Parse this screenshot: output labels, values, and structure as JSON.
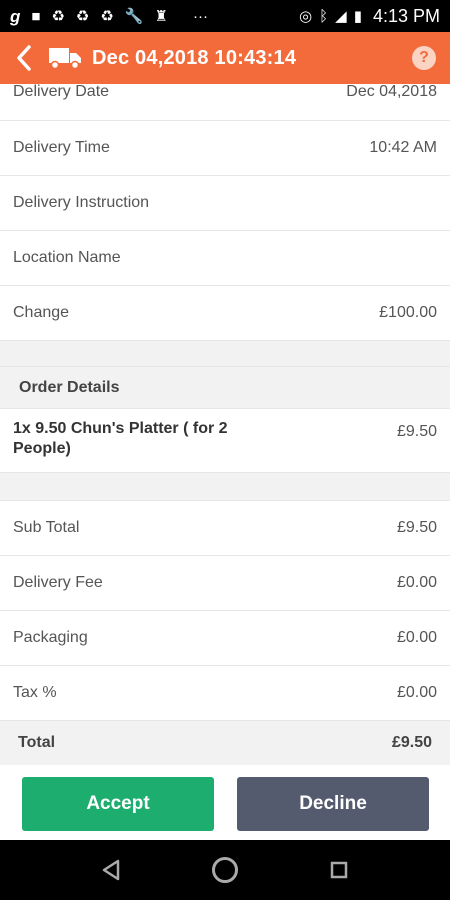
{
  "status_bar": {
    "time": "4:13 PM",
    "icons": [
      "g-icon",
      "square-icon",
      "recycle-icon",
      "recycle-icon",
      "recycle-icon",
      "wrench-icon",
      "person-icon",
      "more-icon",
      "hotspot-icon",
      "bluetooth-icon",
      "signal-icon",
      "battery-icon"
    ],
    "more": "···"
  },
  "header": {
    "title": "Dec 04,2018 10:43:14",
    "help": "?",
    "accent": "#f36a3b"
  },
  "details": [
    {
      "label": "Delivery Date",
      "value": "Dec 04,2018"
    },
    {
      "label": "Delivery Time",
      "value": "10:42 AM"
    },
    {
      "label": "Delivery Instruction",
      "value": ""
    },
    {
      "label": "Location Name",
      "value": ""
    },
    {
      "label": "Change",
      "value": "£100.00"
    }
  ],
  "order": {
    "heading": "Order Details",
    "items": [
      {
        "name": "1x 9.50 Chun's Platter ( for 2 People)",
        "price": "£9.50"
      }
    ]
  },
  "summary": [
    {
      "label": "Sub Total",
      "value": "£9.50"
    },
    {
      "label": "Delivery Fee",
      "value": "£0.00"
    },
    {
      "label": "Packaging",
      "value": "£0.00"
    },
    {
      "label": "Tax %",
      "value": "£0.00"
    }
  ],
  "total": {
    "label": "Total",
    "value": "£9.50"
  },
  "actions": {
    "accept": "Accept",
    "decline": "Decline",
    "accept_color": "#1dae6f",
    "decline_color": "#555b6e"
  }
}
